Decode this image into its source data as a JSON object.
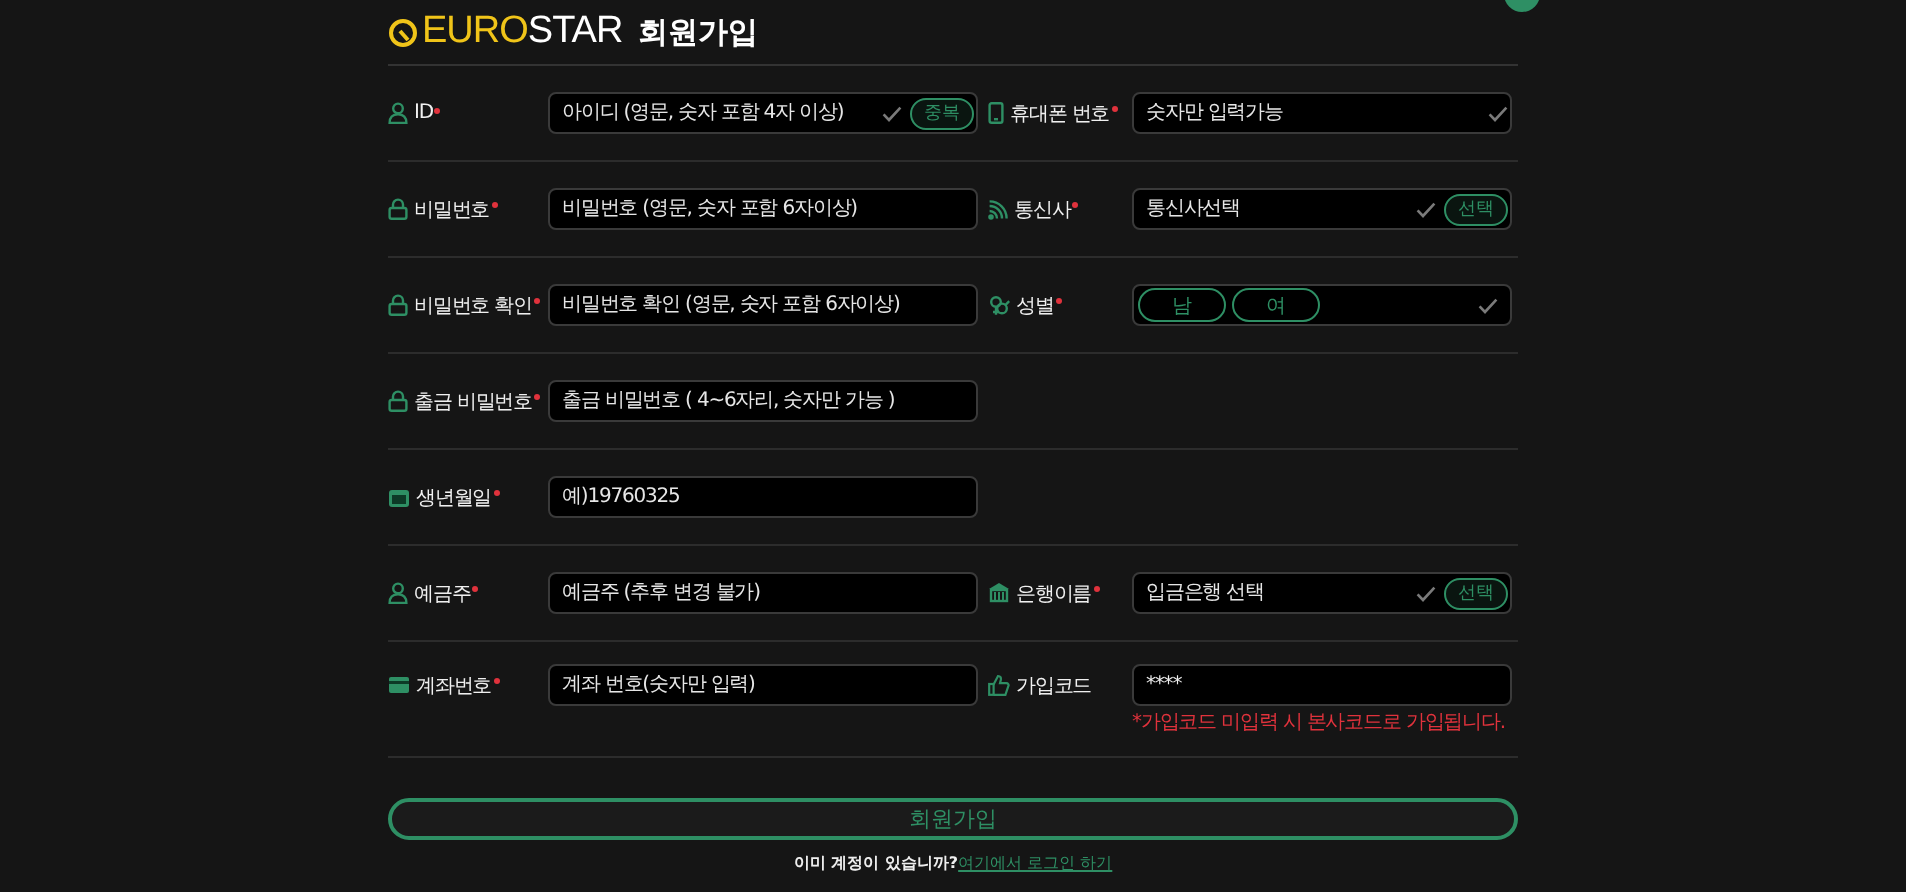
{
  "header": {
    "brand": {
      "accent": "EURO",
      "rest": "STAR"
    },
    "title": "회원가입"
  },
  "rows": [
    {
      "left": {
        "kind": "text",
        "label": "ID",
        "required": true,
        "placeholder": "아이디 (영문, 숫자 포함 4자 이상)",
        "check": true,
        "button": "중복"
      },
      "right": {
        "kind": "text",
        "label": "휴대폰 번호",
        "required": true,
        "placeholder": "숫자만 입력가능",
        "check": true
      }
    },
    {
      "left": {
        "kind": "text",
        "label": "비밀번호",
        "required": true,
        "placeholder": "비밀번호 (영문, 숫자 포함 6자이상)"
      },
      "right": {
        "kind": "text",
        "label": "통신사",
        "required": true,
        "placeholder": "통신사선택",
        "check": true,
        "button": "선택"
      }
    },
    {
      "left": {
        "kind": "text",
        "label": "비밀번호 확인",
        "required": true,
        "placeholder": "비밀번호 확인 (영문, 숫자 포함 6자이상)"
      },
      "right": {
        "kind": "choice",
        "label": "성별",
        "required": true,
        "check": true,
        "options": [
          {
            "label": "남",
            "selected": false
          },
          {
            "label": "여",
            "selected": false
          }
        ]
      }
    },
    {
      "left": {
        "kind": "text",
        "label": "출금 비밀번호",
        "required": true,
        "placeholder": "출금 비밀번호 ( 4~6자리, 숫자만 가능 )"
      }
    },
    {
      "left": {
        "kind": "text",
        "label": "생년월일",
        "required": true,
        "placeholder": "예)19760325"
      }
    },
    {
      "left": {
        "kind": "text",
        "label": "예금주",
        "required": true,
        "placeholder": "예금주 (추후 변경 불가)"
      },
      "right": {
        "kind": "text",
        "label": "은행이름",
        "required": true,
        "placeholder": "입금은행 선택",
        "check": true,
        "button": "선택"
      }
    },
    {
      "left": {
        "kind": "text",
        "label": "계좌번호",
        "required": true,
        "placeholder": "계좌 번호(숫자만 입력)"
      },
      "right": {
        "kind": "text",
        "label": "가입코드",
        "required": false,
        "value": "****",
        "hint": "*가입코드 미입력 시 본사코드로 가입됩니다."
      }
    }
  ],
  "submit": {
    "label": "회원가입"
  },
  "footer": {
    "question": "이미 계정이 있습니까?",
    "link": "여기에서 로그인 하기"
  }
}
